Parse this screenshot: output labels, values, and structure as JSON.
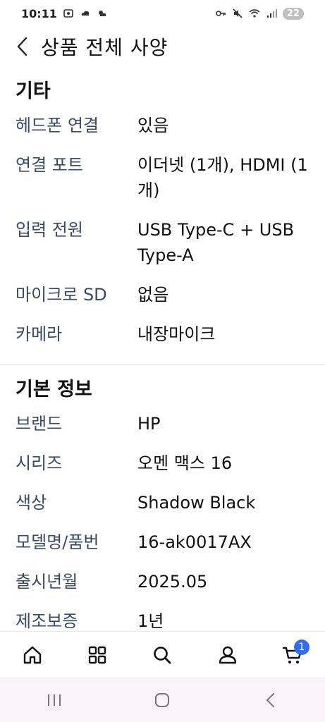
{
  "status_bar": {
    "time": "10:11",
    "battery": "22"
  },
  "header": {
    "title": "상품 전체 사양"
  },
  "sections": [
    {
      "title": "기타",
      "rows": [
        {
          "label": "헤드폰 연결",
          "value": "있음"
        },
        {
          "label": "연결 포트",
          "value": "이더넷 (1개), HDMI (1개)"
        },
        {
          "label": "입력 전원",
          "value": "USB Type-C + USB Type-A"
        },
        {
          "label": "마이크로 SD",
          "value": "없음"
        },
        {
          "label": "카메라",
          "value": "내장마이크"
        }
      ]
    },
    {
      "title": "기본 정보",
      "rows": [
        {
          "label": "브랜드",
          "value": "HP"
        },
        {
          "label": "시리즈",
          "value": "오멘 맥스 16"
        },
        {
          "label": "색상",
          "value": "Shadow Black"
        },
        {
          "label": "모델명/품번",
          "value": "16-ak0017AX"
        },
        {
          "label": "출시년월",
          "value": "2025.05"
        },
        {
          "label": "제조보증",
          "value": "1년"
        }
      ]
    }
  ],
  "bottom_nav": {
    "items": [
      {
        "name": "home-icon"
      },
      {
        "name": "grid-icon"
      },
      {
        "name": "search-icon"
      },
      {
        "name": "user-icon"
      },
      {
        "name": "cart-icon"
      }
    ],
    "cart_badge": "1"
  },
  "system_nav": {
    "items": [
      "recents-icon",
      "home-circle-icon",
      "back-icon"
    ]
  },
  "colors": {
    "label": "#3a4a63",
    "badge": "#2f6df6",
    "system_nav_bg": "#f9f2f7"
  }
}
